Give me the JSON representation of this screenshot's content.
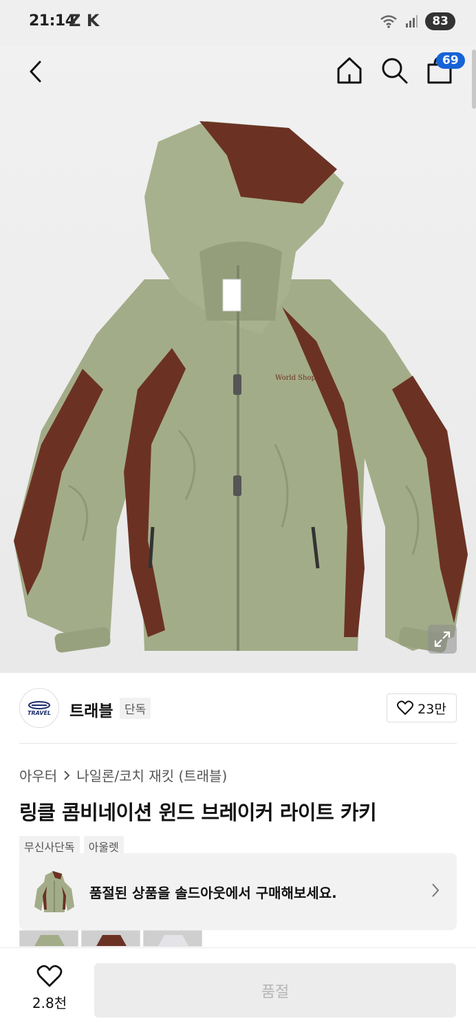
{
  "status": {
    "time": "21:14",
    "app_icons": "Z K",
    "battery": "83"
  },
  "nav": {
    "cart_count": "69"
  },
  "brand": {
    "name": "트래블",
    "tag": "단독",
    "likes": "23만",
    "logo_text": "TRAVEL"
  },
  "breadcrumb": {
    "category": "아우터",
    "sub_category": "나일론/코치 재킷 (트래블)"
  },
  "product": {
    "title": "링클 콤비네이션 윈드 브레이커 라이트 카키",
    "tags": [
      "무신사단독",
      "아울렛"
    ]
  },
  "resell": {
    "text": "품절된 상품을 솔드아웃에서 구매해보세요."
  },
  "bottom": {
    "like_count": "2.8천",
    "buy_label": "품절"
  },
  "colors": {
    "khaki": "#9fa983",
    "brown": "#6b3224",
    "accent_blue": "#1663d7"
  }
}
